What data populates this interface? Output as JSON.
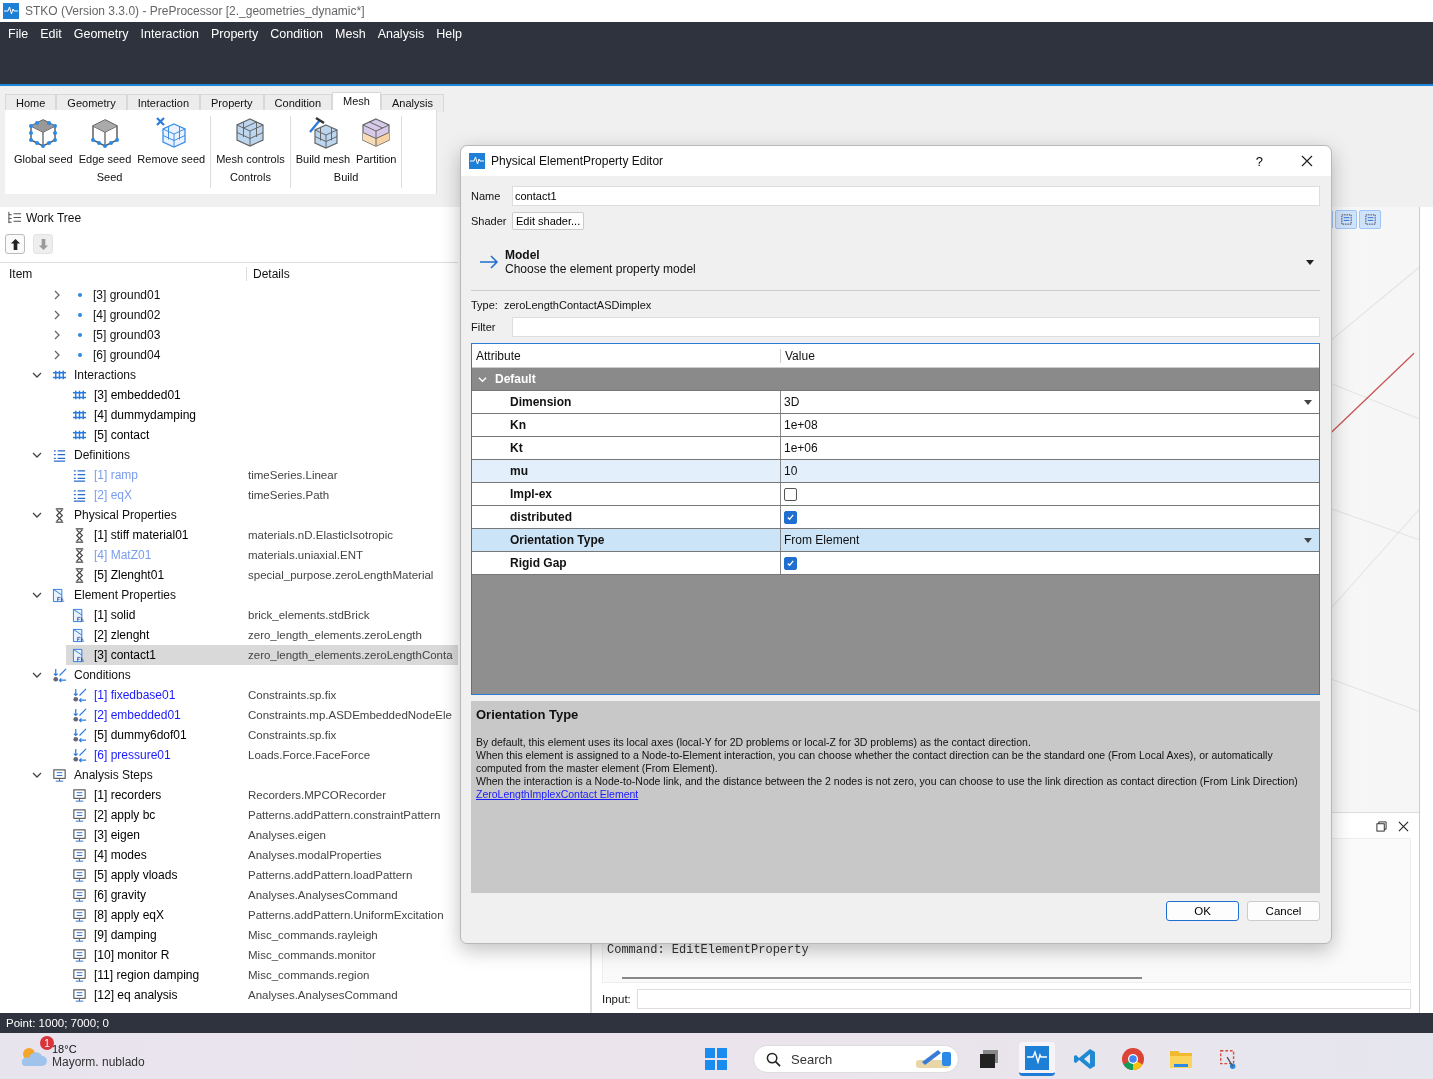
{
  "window": {
    "title": "STKO (Version 3.3.0) - PreProcessor [2._geometries_dynamic*]"
  },
  "menu": [
    "File",
    "Edit",
    "Geometry",
    "Interaction",
    "Property",
    "Condition",
    "Mesh",
    "Analysis",
    "Help"
  ],
  "ribbon_tabs": [
    {
      "label": "Home",
      "selected": false
    },
    {
      "label": "Geometry",
      "selected": false
    },
    {
      "label": "Interaction",
      "selected": false
    },
    {
      "label": "Property",
      "selected": false
    },
    {
      "label": "Condition",
      "selected": false
    },
    {
      "label": "Mesh",
      "selected": true
    },
    {
      "label": "Analysis",
      "selected": false
    }
  ],
  "ribbon_groups": [
    {
      "label": "Seed",
      "buttons": [
        {
          "label": "Global seed",
          "kind": "global_seed"
        },
        {
          "label": "Edge seed",
          "kind": "edge_seed"
        },
        {
          "label": "Remove seed",
          "kind": "remove_seed"
        }
      ]
    },
    {
      "label": "Controls",
      "buttons": [
        {
          "label": "Mesh controls",
          "kind": "mesh_controls"
        }
      ]
    },
    {
      "label": "Build",
      "buttons": [
        {
          "label": "Build mesh",
          "kind": "build_mesh"
        },
        {
          "label": "Partition",
          "kind": "partition"
        }
      ]
    }
  ],
  "work_tree": {
    "title": "Work Tree",
    "nav_buttons": [
      {
        "kind": "up",
        "disabled": false
      },
      {
        "kind": "down",
        "disabled": true
      }
    ],
    "columns": [
      "Item",
      "Details"
    ],
    "partial_items": [
      {
        "label": "[3] ground01",
        "expanded": false,
        "selected": false
      },
      {
        "label": "[4] ground02",
        "expanded": false,
        "selected": false
      },
      {
        "label": "[5] ground03",
        "expanded": false,
        "selected": false
      },
      {
        "label": "[6] ground04",
        "expanded": false,
        "selected": false
      }
    ],
    "groups": [
      {
        "label": "Interactions",
        "kind": "interaction",
        "expanded": true,
        "selected": false,
        "children": [
          {
            "label": "[3] embedded01",
            "color": "#000000",
            "selected": false
          },
          {
            "label": "[4] dummydamping",
            "color": "#000000",
            "selected": false
          },
          {
            "label": "[5] contact",
            "color": "#000000",
            "selected": false
          }
        ]
      },
      {
        "label": "Definitions",
        "kind": "definition",
        "expanded": true,
        "selected": false,
        "children": [
          {
            "label": "[1] ramp",
            "details": "timeSeries.Linear",
            "color": "#7a9cf0",
            "selected": false
          },
          {
            "label": "[2] eqX",
            "details": "timeSeries.Path",
            "color": "#7a9cf0",
            "selected": false
          }
        ]
      },
      {
        "label": "Physical Properties",
        "kind": "physical",
        "expanded": true,
        "selected": false,
        "children": [
          {
            "label": "[1] stiff material01",
            "details": "materials.nD.ElasticIsotropic",
            "color": "#000000",
            "selected": false
          },
          {
            "label": "[4] MatZ01",
            "details": "materials.uniaxial.ENT",
            "color": "#7a9cf0",
            "selected": false
          },
          {
            "label": "[5] Zlenght01",
            "details": "special_purpose.zeroLengthMaterial",
            "color": "#000000",
            "selected": false
          }
        ]
      },
      {
        "label": "Element Properties",
        "kind": "element",
        "expanded": true,
        "selected": false,
        "children": [
          {
            "label": "[1] solid",
            "details": "brick_elements.stdBrick",
            "color": "#000000",
            "selected": false
          },
          {
            "label": "[2] zlenght",
            "details": "zero_length_elements.zeroLength",
            "color": "#000000",
            "selected": false
          },
          {
            "label": "[3] contact1",
            "details": "zero_length_elements.zeroLengthConta",
            "color": "#000000",
            "selected": true
          }
        ]
      },
      {
        "label": "Conditions",
        "kind": "condition",
        "expanded": true,
        "selected": false,
        "children": [
          {
            "label": "[1] fixedbase01",
            "details": "Constraints.sp.fix",
            "color": "#1a1aff",
            "selected": false
          },
          {
            "label": "[2] embedded01",
            "details": "Constraints.mp.ASDEmbeddedNodeEle",
            "color": "#1a1aff",
            "selected": false
          },
          {
            "label": "[5] dummy6dof01",
            "details": "Constraints.sp.fix",
            "color": "#000000",
            "selected": false
          },
          {
            "label": "[6] pressure01",
            "details": "Loads.Force.FaceForce",
            "color": "#1a1aff",
            "selected": false
          }
        ]
      },
      {
        "label": "Analysis Steps",
        "kind": "analysis",
        "expanded": true,
        "selected": false,
        "children": [
          {
            "label": "[1] recorders",
            "details": "Recorders.MPCORecorder",
            "color": "#000000",
            "selected": false
          },
          {
            "label": "[2] apply bc",
            "details": "Patterns.addPattern.constraintPattern",
            "color": "#000000",
            "selected": false
          },
          {
            "label": "[3] eigen",
            "details": "Analyses.eigen",
            "color": "#000000",
            "selected": false
          },
          {
            "label": "[4] modes",
            "details": "Analyses.modalProperties",
            "color": "#000000",
            "selected": false
          },
          {
            "label": "[5] apply vloads",
            "details": "Patterns.addPattern.loadPattern",
            "color": "#000000",
            "selected": false
          },
          {
            "label": "[6] gravity",
            "details": "Analyses.AnalysesCommand",
            "color": "#000000",
            "selected": false
          },
          {
            "label": "[8] apply eqX",
            "details": "Patterns.addPattern.UniformExcitation",
            "color": "#000000",
            "selected": false
          },
          {
            "label": "[9] damping",
            "details": "Misc_commands.rayleigh",
            "color": "#000000",
            "selected": false
          },
          {
            "label": "[10] monitor R",
            "details": "Misc_commands.monitor",
            "color": "#000000",
            "selected": false
          },
          {
            "label": "[11] region damping",
            "details": "Misc_commands.region",
            "color": "#000000",
            "selected": false
          },
          {
            "label": "[12] eq analysis",
            "details": "Analyses.AnalysesCommand",
            "color": "#000000",
            "selected": false
          }
        ]
      }
    ]
  },
  "console": {
    "command": "Command: EditElementProperty",
    "input_label": "Input:"
  },
  "status_bar": "Point: 1000; 7000; 0",
  "dialog": {
    "title": "Physical ElementProperty Editor",
    "help_button": "?",
    "name_label": "Name",
    "name_value": "contact1",
    "shader_label": "Shader",
    "shader_button": "Edit shader...",
    "model_title": "Model",
    "model_subtitle": "Choose the element property model",
    "type_label": "Type:",
    "type_value": "zeroLengthContactASDimplex",
    "filter_label": "Filter",
    "table_columns": [
      "Attribute",
      "Value"
    ],
    "group": {
      "label": "Default",
      "expanded": true
    },
    "rows": [
      {
        "attribute": "Dimension",
        "kind": "combo",
        "value": "3D",
        "selected": false,
        "hovered": false
      },
      {
        "attribute": "Kn",
        "kind": "text",
        "value": "1e+08",
        "selected": false,
        "hovered": false
      },
      {
        "attribute": "Kt",
        "kind": "text",
        "value": "1e+06",
        "selected": false,
        "hovered": false
      },
      {
        "attribute": "mu",
        "kind": "text",
        "value": "10",
        "selected": false,
        "hovered": true
      },
      {
        "attribute": "Impl-ex",
        "kind": "checkbox",
        "checked": false,
        "selected": false,
        "hovered": false
      },
      {
        "attribute": "distributed",
        "kind": "checkbox",
        "checked": true,
        "selected": false,
        "hovered": false
      },
      {
        "attribute": "Orientation Type",
        "kind": "combo",
        "value": "From Element",
        "selected": true,
        "hovered": false
      },
      {
        "attribute": "Rigid Gap",
        "kind": "checkbox",
        "checked": true,
        "selected": false,
        "hovered": false
      }
    ],
    "help_title": "Orientation Type",
    "help_paragraphs": [
      "By default, this element uses its local axes (local-Y for 2D problems or local-Z for 3D problems) as the contact direction.",
      "When this element is assigned to a Node-to-Element interaction, you can choose whether the contact direction can be the standard one (From Local Axes), or automatically computed from the master element (From Element).",
      "When the interaction is a Node-to-Node link, and the distance between the 2 nodes is not zero, you can choose to use the link direction as contact direction (From Link Direction)"
    ],
    "help_link": "ZeroLengthImplexContact Element",
    "buttons": [
      {
        "label": "OK",
        "default": true
      },
      {
        "label": "Cancel",
        "default": false
      }
    ]
  },
  "taskbar": {
    "weather_badge": "1",
    "temperature": "18°C",
    "weather": "Mayorm. nublado",
    "search_placeholder": "Search",
    "apps": [
      {
        "kind": "task_view",
        "active": false
      },
      {
        "kind": "stko",
        "active": true
      },
      {
        "kind": "code",
        "active": false
      },
      {
        "kind": "browser",
        "active": false
      },
      {
        "kind": "folder",
        "active": false
      },
      {
        "kind": "snip",
        "active": false
      }
    ]
  }
}
